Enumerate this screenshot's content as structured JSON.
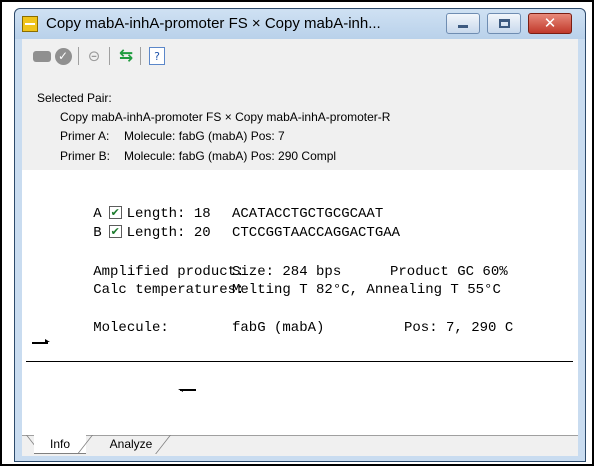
{
  "window": {
    "title": "Copy mabA-inhA-promoter FS × Copy mabA-inh...",
    "accent": "#c9dcf0",
    "close_color": "#c0392b"
  },
  "toolbar": {
    "buttons": [
      "record-icon",
      "check-circle-icon",
      "link-icon",
      "swap-arrows-icon",
      "help-document-icon"
    ]
  },
  "selection": {
    "label": "Selected Pair:",
    "pair_name": "Copy mabA-inhA-promoter FS × Copy mabA-inhA-promoter-R",
    "primer_a": {
      "label": "Primer A:",
      "detail": "Molecule: fabG (mabA)  Pos: 7"
    },
    "primer_b": {
      "label": "Primer B:",
      "detail": "Molecule: fabG (mabA)  Pos: 290 Compl"
    }
  },
  "primers": [
    {
      "id": "A",
      "checked": true,
      "length_label": "Length: 18",
      "sequence": "ACATACCTGCTGCGCAAT"
    },
    {
      "id": "B",
      "checked": true,
      "length_label": "Length: 20",
      "sequence": "CTCCGGTAACCAGGACTGAA"
    }
  ],
  "product": {
    "amplified_label": "Amplified product:",
    "size": "Size: 284 bps",
    "gc": "Product GC 60%",
    "calc_label": "Calc temperatures:",
    "temps": "Melting T 82°C, Annealing T 55°C"
  },
  "molecule": {
    "label": "Molecule:",
    "name": "fabG (mabA)",
    "pos": "Pos: 7, 290 C"
  },
  "tabs": [
    "Info",
    "Analyze"
  ]
}
